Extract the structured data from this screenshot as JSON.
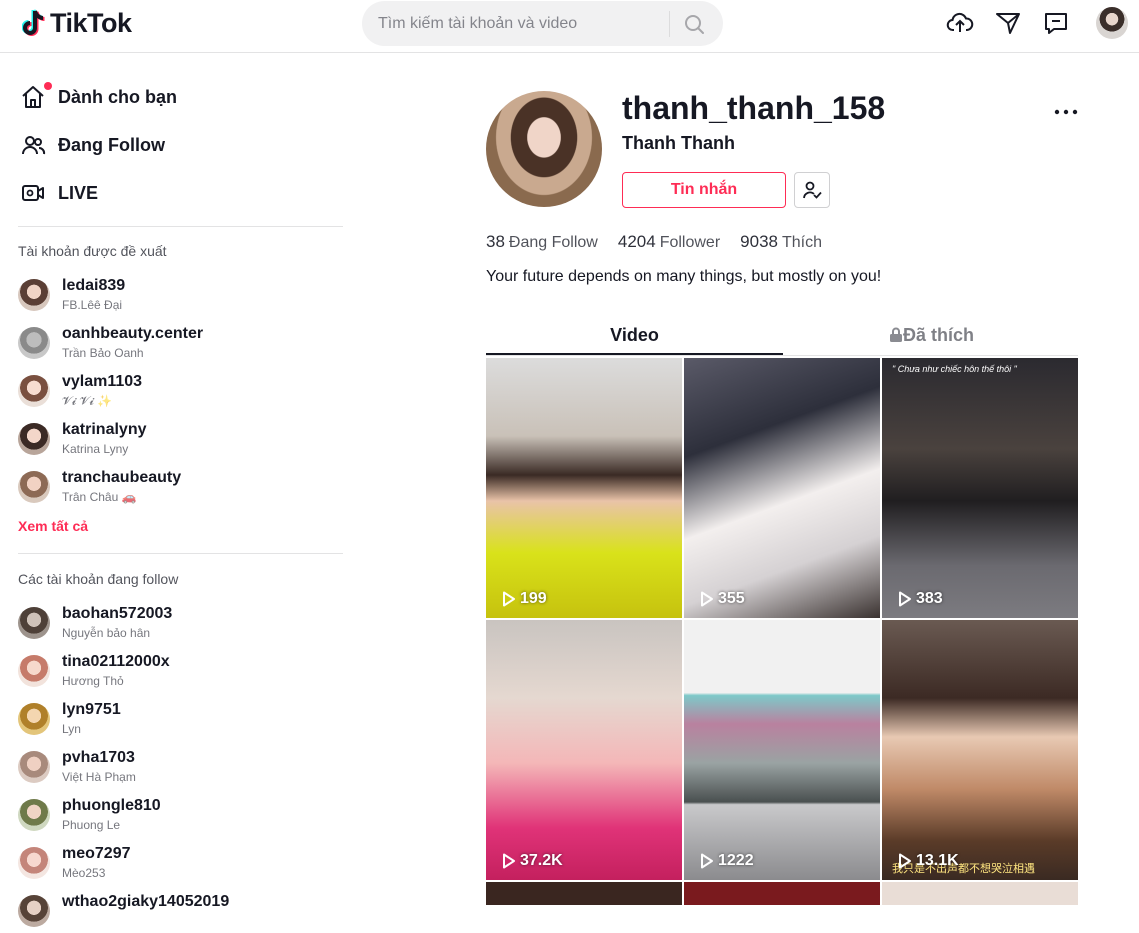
{
  "header": {
    "logo_text": "TikTok",
    "search_placeholder": "Tìm kiếm tài khoản và video"
  },
  "nav": [
    {
      "label": "Dành cho bạn",
      "icon": "home-icon"
    },
    {
      "label": "Đang Follow",
      "icon": "users-icon"
    },
    {
      "label": "LIVE",
      "icon": "live-icon"
    }
  ],
  "suggested": {
    "title": "Tài khoản được đề xuất",
    "accounts": [
      {
        "username": "ledai839",
        "nickname": "FB.Lêê Đại"
      },
      {
        "username": "oanhbeauty.center",
        "nickname": "Trần Bảo Oanh"
      },
      {
        "username": "vylam1103",
        "nickname": "𝓥𝓲 𝓥𝓲 ✨"
      },
      {
        "username": "katrinalyny",
        "nickname": "Katrina Lyny"
      },
      {
        "username": "tranchaubeauty",
        "nickname": "Trân Châu 🚗"
      }
    ],
    "see_all": "Xem tất cả"
  },
  "following": {
    "title": "Các tài khoản đang follow",
    "accounts": [
      {
        "username": "baohan572003",
        "nickname": "Nguyễn bảo hân"
      },
      {
        "username": "tina02112000x",
        "nickname": "Hương Thỏ"
      },
      {
        "username": "lyn9751",
        "nickname": "Lyn"
      },
      {
        "username": "pvha1703",
        "nickname": "Việt Hà Phạm"
      },
      {
        "username": "phuongle810",
        "nickname": "Phuong Le"
      },
      {
        "username": "meo7297",
        "nickname": "Mèo253"
      },
      {
        "username": "wthao2giaky14052019",
        "nickname": ""
      }
    ]
  },
  "profile": {
    "username": "thanh_thanh_158",
    "nickname": "Thanh Thanh",
    "message_button": "Tin nhắn",
    "stats": [
      {
        "value": "38",
        "label": "Đang Follow"
      },
      {
        "value": "4204",
        "label": "Follower"
      },
      {
        "value": "9038",
        "label": "Thích"
      }
    ],
    "bio": "Your future depends on many things, but mostly on you!",
    "tabs": {
      "video": "Video",
      "liked": "Đã thích"
    }
  },
  "videos": [
    {
      "views": "199"
    },
    {
      "views": "355"
    },
    {
      "views": "383",
      "caption": "\" Chưa như chiếc hôn thế thôi \""
    },
    {
      "views": "37.2K"
    },
    {
      "views": "1222"
    },
    {
      "views": "13.1K",
      "caption": "我只是不出声都不想哭泣相遇"
    }
  ],
  "colors": {
    "accent": "#fe2c55",
    "text": "#161823"
  }
}
